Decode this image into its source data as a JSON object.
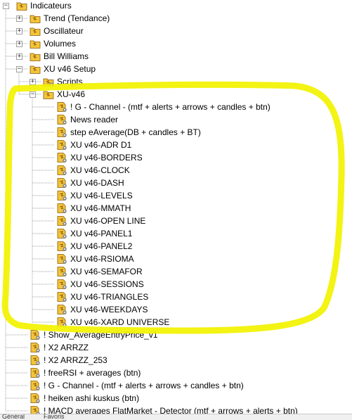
{
  "tree": {
    "nodes": [
      {
        "id": "indicateurs",
        "label": "Indicateurs",
        "level": 0,
        "expander": "minus",
        "icon": "folder-indicator-icon"
      },
      {
        "id": "trend",
        "label": "Trend (Tendance)",
        "level": 1,
        "expander": "plus",
        "icon": "folder-indicator-icon"
      },
      {
        "id": "oscillateur",
        "label": "Oscillateur",
        "level": 1,
        "expander": "plus",
        "icon": "folder-indicator-icon"
      },
      {
        "id": "volumes",
        "label": "Volumes",
        "level": 1,
        "expander": "plus",
        "icon": "folder-indicator-icon"
      },
      {
        "id": "bill-williams",
        "label": "Bill Williams",
        "level": 1,
        "expander": "plus",
        "icon": "folder-indicator-icon"
      },
      {
        "id": "xu-v46-setup",
        "label": "XU v46 Setup",
        "level": 1,
        "expander": "minus",
        "icon": "folder-indicator-icon"
      },
      {
        "id": "scripts",
        "label": "Scripts",
        "level": 2,
        "expander": "plus",
        "icon": "folder-script-icon"
      },
      {
        "id": "xu-v46",
        "label": "XU-v46",
        "level": 2,
        "expander": "minus",
        "icon": "folder-indicator-icon"
      },
      {
        "id": "g-channel-1",
        "label": "! G - Channel - (mtf + alerts + arrows + candles + btn)",
        "level": 3,
        "icon": "indicator-icon"
      },
      {
        "id": "news-reader",
        "label": "News reader",
        "level": 3,
        "icon": "indicator-icon"
      },
      {
        "id": "step-eaverage",
        "label": "step eAverage(DB + candles + BT)",
        "level": 3,
        "icon": "indicator-icon"
      },
      {
        "id": "adr-d1",
        "label": "XU v46-ADR D1",
        "level": 3,
        "icon": "indicator-icon"
      },
      {
        "id": "borders",
        "label": "XU v46-BORDERS",
        "level": 3,
        "icon": "indicator-icon"
      },
      {
        "id": "clock",
        "label": "XU v46-CLOCK",
        "level": 3,
        "icon": "indicator-icon"
      },
      {
        "id": "dash",
        "label": "XU v46-DASH",
        "level": 3,
        "icon": "indicator-icon"
      },
      {
        "id": "levels",
        "label": "XU v46-LEVELS",
        "level": 3,
        "icon": "indicator-icon"
      },
      {
        "id": "mmath",
        "label": "XU v46-MMATH",
        "level": 3,
        "icon": "indicator-icon"
      },
      {
        "id": "open-line",
        "label": "XU v46-OPEN LINE",
        "level": 3,
        "icon": "indicator-icon"
      },
      {
        "id": "panel1",
        "label": "XU v46-PANEL1",
        "level": 3,
        "icon": "indicator-icon"
      },
      {
        "id": "panel2",
        "label": "XU v46-PANEL2",
        "level": 3,
        "icon": "indicator-icon"
      },
      {
        "id": "rsioma",
        "label": "XU v46-RSIOMA",
        "level": 3,
        "icon": "indicator-icon"
      },
      {
        "id": "semafor",
        "label": "XU v46-SEMAFOR",
        "level": 3,
        "icon": "indicator-icon"
      },
      {
        "id": "sessions",
        "label": "XU v46-SESSIONS",
        "level": 3,
        "icon": "indicator-icon"
      },
      {
        "id": "triangles",
        "label": "XU v46-TRIANGLES",
        "level": 3,
        "icon": "indicator-icon"
      },
      {
        "id": "weekdays",
        "label": "XU v46-WEEKDAYS",
        "level": 3,
        "icon": "indicator-icon"
      },
      {
        "id": "xard-universe",
        "label": "XU v46-XARD UNIVERSE",
        "level": 3,
        "icon": "indicator-icon"
      },
      {
        "id": "show-avg-entry",
        "label": "! Show_AverageEntryPrice_v1",
        "level": 1,
        "icon": "indicator-icon"
      },
      {
        "id": "x2-arrzz",
        "label": "! X2 ARRZZ",
        "level": 1,
        "icon": "indicator-icon"
      },
      {
        "id": "x2-arrzz-253",
        "label": "! X2 ARRZZ_253",
        "level": 1,
        "icon": "indicator-icon"
      },
      {
        "id": "freersi",
        "label": "! freeRSI + averages (btn)",
        "level": 1,
        "icon": "indicator-icon"
      },
      {
        "id": "g-channel-2",
        "label": "! G - Channel - (mtf + alerts + arrows + candles + btn)",
        "level": 1,
        "icon": "indicator-icon"
      },
      {
        "id": "heiken-ashi",
        "label": "! heiken ashi kuskus (btn)",
        "level": 1,
        "icon": "indicator-icon"
      },
      {
        "id": "macd-averages",
        "label": "! MACD averages FlatMarket - Detector (mtf + arrows + alerts + btn)",
        "level": 1,
        "icon": "indicator-icon"
      }
    ]
  },
  "status": {
    "left_text": "Général",
    "tab_text": "Favoris"
  },
  "colors": {
    "highlight": "#f2f200",
    "icon_gold": "#f3c53a",
    "icon_brown": "#8a5a0a",
    "gear": "#8c8c8c",
    "guide": "#a0a0a0"
  }
}
